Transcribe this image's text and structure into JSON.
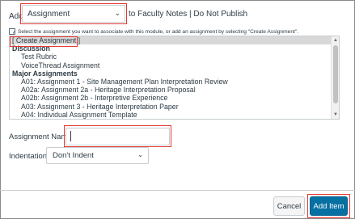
{
  "header": {
    "add_label": "Add",
    "item_type_selected": "Assignment",
    "destination_text": "to Faculty Notes | Do Not Publish"
  },
  "instructions": "Select the assignment you want to associate with this module, or add an assignment by selecting \"Create Assignment\".",
  "assignment_list": {
    "options": [
      {
        "label": "[ Create Assignment ]",
        "kind": "create",
        "selected": true
      },
      {
        "label": "Discussion",
        "kind": "group"
      },
      {
        "label": "Test Rubric",
        "kind": "child"
      },
      {
        "label": "VoiceThread Assignment",
        "kind": "child"
      },
      {
        "label": "Major Assignments",
        "kind": "group"
      },
      {
        "label": "A01: Assignment 1 - Site Management Plan Interpretation Review",
        "kind": "child"
      },
      {
        "label": "A02a: Assignment 2a - Heritage Interpretation Proposal",
        "kind": "child"
      },
      {
        "label": "A02b: Assignment 2b - Interpretive Experience",
        "kind": "child"
      },
      {
        "label": "A03: Assignment 3 - Heritage Interpretation Paper",
        "kind": "child"
      },
      {
        "label": "A04: Individual Assignment Template",
        "kind": "child"
      }
    ]
  },
  "form": {
    "assignment_name_label": "Assignment Name:",
    "assignment_name_value": "",
    "indentation_label": "Indentation:",
    "indentation_value": "Don't Indent"
  },
  "footer": {
    "cancel_label": "Cancel",
    "add_item_label": "Add Item"
  },
  "colors": {
    "primary_button": "#0770a3",
    "highlight": "#e53935",
    "text": "#2d3b45"
  }
}
